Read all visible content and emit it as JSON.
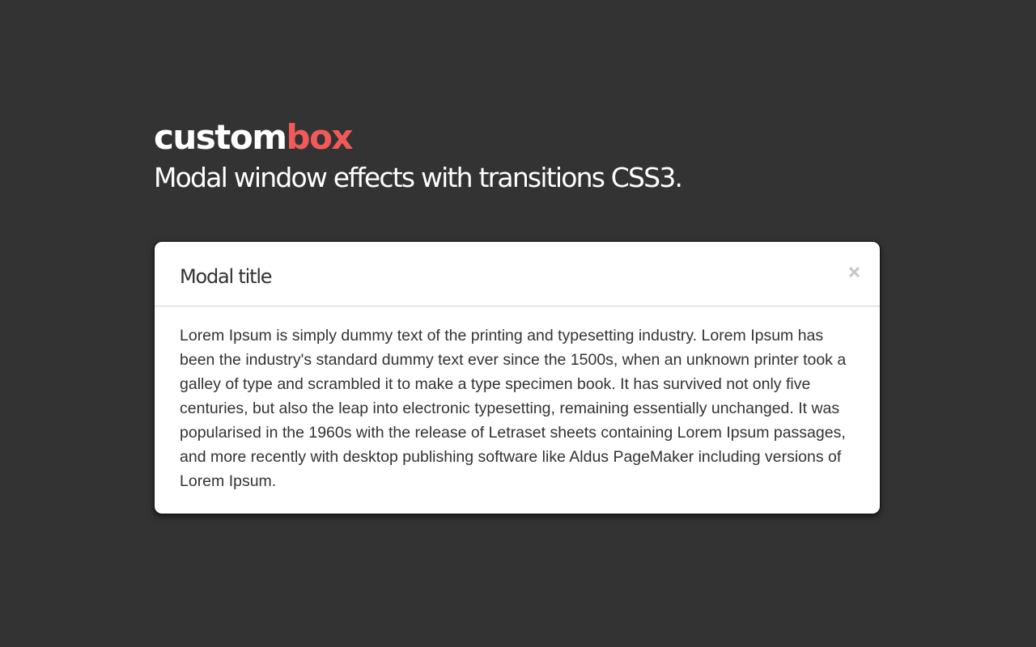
{
  "header": {
    "brand_part1": "custom",
    "brand_part2": "box",
    "tagline": "Modal window effects with transitions CSS3."
  },
  "modal": {
    "title": "Modal title",
    "close_icon": "close-icon",
    "close_label": "×",
    "body_text": "Lorem Ipsum is simply dummy text of the printing and typesetting industry. Lorem Ipsum has been the industry's standard dummy text ever since the 1500s, when an unknown printer took a galley of type and scrambled it to make a type specimen book. It has survived not only five centuries, but also the leap into electronic typesetting, remaining essentially unchanged. It was popularised in the 1960s with the release of Letraset sheets containing Lorem Ipsum passages, and more recently with desktop publishing software like Aldus PageMaker including versions of Lorem Ipsum."
  },
  "colors": {
    "background": "#333333",
    "accent": "#f25a5a",
    "text_light": "#ffffff",
    "text_dark": "#333333",
    "modal_bg": "#ffffff",
    "close_icon": "#c8c8c8"
  }
}
